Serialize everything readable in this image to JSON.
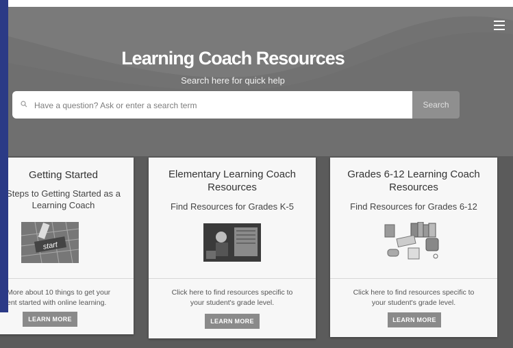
{
  "hero": {
    "title": "Learning Coach Resources",
    "subtitle": "Search here for quick help",
    "menu_icon": "hamburger-menu-icon"
  },
  "search": {
    "placeholder": "Have a question? Ask or enter a search term",
    "button_label": "Search",
    "icon": "search-icon"
  },
  "cards": [
    {
      "title": "Getting Started",
      "subtitle": "Steps to Getting Started as a Learning Coach",
      "image": "start-keyboard-image",
      "description_line1": "More about 10 things to get your",
      "description_line2": "ent started with online learning.",
      "button_label": "LEARN MORE"
    },
    {
      "title_line1": "Elementary Learning Coach",
      "title_line2": "Resources",
      "subtitle": "Find Resources for Grades K-5",
      "image": "elementary-photo-image",
      "description_line1": "Click here to find resources specific to",
      "description_line2": "your student's grade level.",
      "button_label": "LEARN MORE"
    },
    {
      "title_line1": "Grades 6-12 Learning Coach",
      "title_line2": "Resources",
      "subtitle": "Find Resources for Grades 6-12",
      "image": "school-supplies-image",
      "description_line1": "Click here to find resources specific to",
      "description_line2": "your student's grade level.",
      "button_label": "LEARN MORE"
    }
  ],
  "colors": {
    "hero_background": "#6f6f6f",
    "page_background": "#5b5b5b",
    "left_bar": "#2b3a86",
    "card_background": "#f7f7f7",
    "button_gray": "#8a8a8a"
  }
}
